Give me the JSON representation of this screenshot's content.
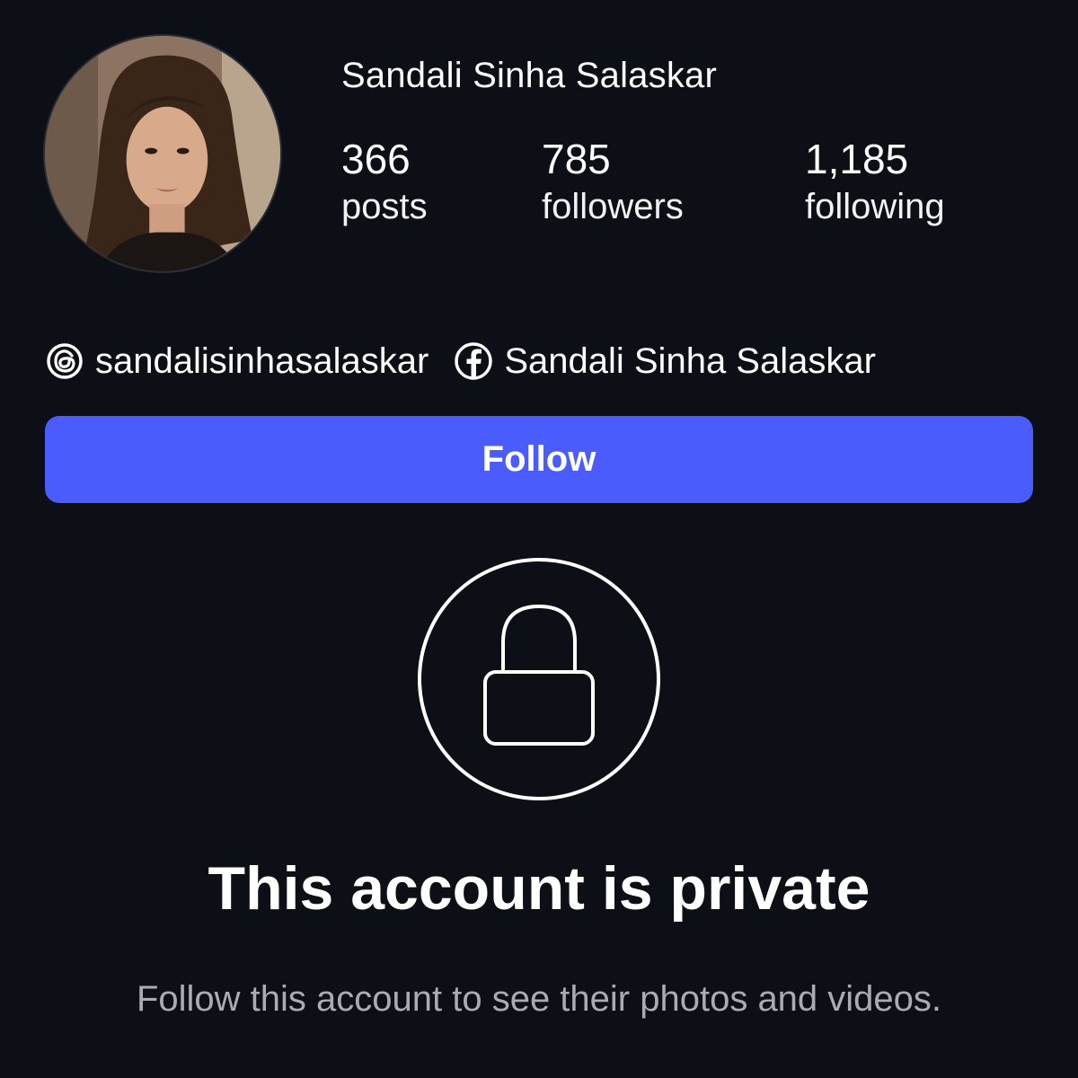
{
  "profile": {
    "display_name": "Sandali Sinha Salaskar",
    "avatar": "avatar-photo"
  },
  "stats": {
    "posts": {
      "count": "366",
      "label": "posts"
    },
    "followers": {
      "count": "785",
      "label": "followers"
    },
    "following": {
      "count": "1,185",
      "label": "following"
    }
  },
  "links": {
    "threads": {
      "icon": "threads-icon",
      "text": "sandalisinhasalaskar"
    },
    "facebook": {
      "icon": "facebook-icon",
      "text": "Sandali Sinha Salaskar"
    }
  },
  "follow_button": {
    "label": "Follow",
    "color": "#4a5dfc"
  },
  "private_notice": {
    "icon": "lock-icon",
    "title": "This account is private",
    "subtitle": "Follow this account to see their photos and videos."
  },
  "colors": {
    "background": "#0c0f16",
    "accent": "#4a5dfc",
    "muted_text": "#a8acb5"
  }
}
